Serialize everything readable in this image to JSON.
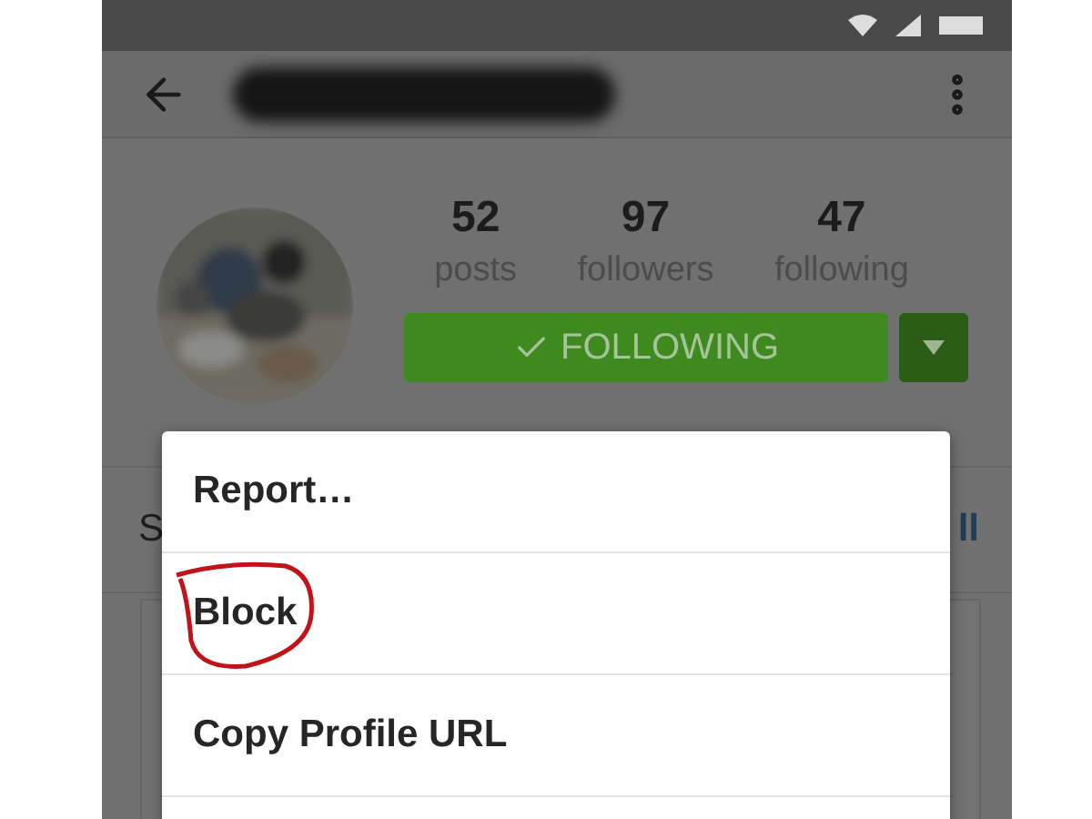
{
  "stats": [
    {
      "value": "52",
      "label": "posts"
    },
    {
      "value": "97",
      "label": "followers"
    },
    {
      "value": "47",
      "label": "following"
    }
  ],
  "follow_button": {
    "label": "FOLLOWING"
  },
  "section": {
    "title_partial": "S",
    "link_partial": "ll"
  },
  "menu": {
    "items": [
      {
        "label": "Report…",
        "circled": false
      },
      {
        "label": "Block",
        "circled": true
      },
      {
        "label": "Copy Profile URL",
        "circled": false
      }
    ]
  }
}
